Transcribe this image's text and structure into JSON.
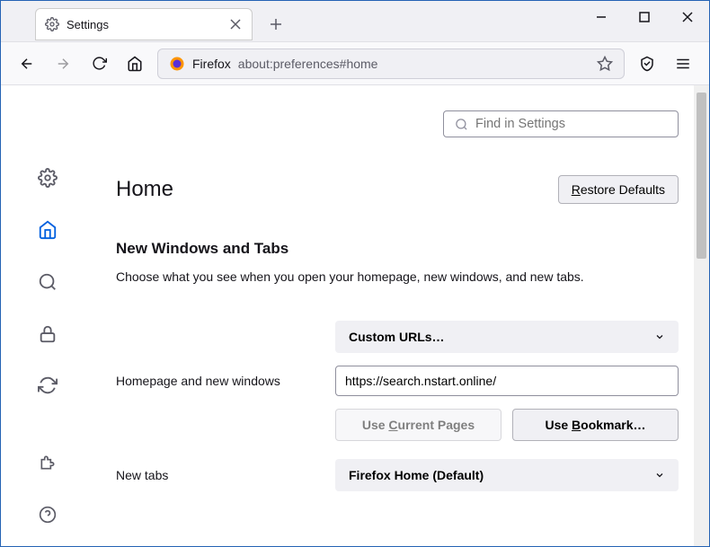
{
  "window": {
    "tab_title": "Settings",
    "scheme_label": "Firefox",
    "url": "about:preferences#home"
  },
  "search": {
    "placeholder": "Find in Settings"
  },
  "header": {
    "title": "Home",
    "restore_label": "Restore Defaults"
  },
  "section": {
    "title": "New Windows and Tabs",
    "description": "Choose what you see when you open your homepage, new windows, and new tabs."
  },
  "homepage": {
    "label": "Homepage and new windows",
    "select_value": "Custom URLs…",
    "url_value": "https://search.nstart.online/",
    "use_current_label": "Use Current Pages",
    "use_bookmark_label": "Use Bookmark…"
  },
  "newtabs": {
    "label": "New tabs",
    "select_value": "Firefox Home (Default)"
  }
}
